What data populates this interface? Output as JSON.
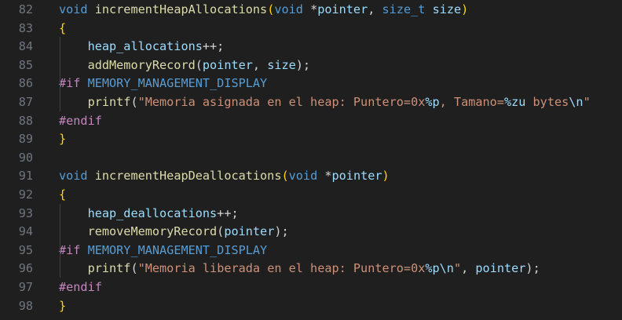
{
  "lines": [
    {
      "num": "82",
      "tokens": [
        {
          "t": "void",
          "c": "kw"
        },
        {
          "t": " ",
          "c": "plain"
        },
        {
          "t": "incrementHeapAllocations",
          "c": "fn"
        },
        {
          "t": "(",
          "c": "bracket"
        },
        {
          "t": "void",
          "c": "kw"
        },
        {
          "t": " *",
          "c": "plain"
        },
        {
          "t": "pointer",
          "c": "var"
        },
        {
          "t": ", ",
          "c": "plain"
        },
        {
          "t": "size_t",
          "c": "kw"
        },
        {
          "t": " ",
          "c": "plain"
        },
        {
          "t": "size",
          "c": "var"
        },
        {
          "t": ")",
          "c": "bracket"
        }
      ]
    },
    {
      "num": "83",
      "tokens": [
        {
          "t": "{",
          "c": "bracket"
        }
      ]
    },
    {
      "num": "84",
      "tokens": [
        {
          "t": "    ",
          "c": "plain"
        },
        {
          "t": "heap_allocations",
          "c": "var"
        },
        {
          "t": "++;",
          "c": "plain"
        }
      ]
    },
    {
      "num": "85",
      "tokens": [
        {
          "t": "    ",
          "c": "plain"
        },
        {
          "t": "addMemoryRecord",
          "c": "fn"
        },
        {
          "t": "(",
          "c": "plain"
        },
        {
          "t": "pointer",
          "c": "var"
        },
        {
          "t": ", ",
          "c": "plain"
        },
        {
          "t": "size",
          "c": "var"
        },
        {
          "t": ");",
          "c": "plain"
        }
      ]
    },
    {
      "num": "86",
      "tokens": [
        {
          "t": "#if",
          "c": "pre"
        },
        {
          "t": " ",
          "c": "plain"
        },
        {
          "t": "MEMORY_MANAGEMENT_DISPLAY",
          "c": "mac"
        }
      ]
    },
    {
      "num": "87",
      "tokens": [
        {
          "t": "    ",
          "c": "plain"
        },
        {
          "t": "printf",
          "c": "fn"
        },
        {
          "t": "(",
          "c": "plain"
        },
        {
          "t": "\"Memoria asignada en el heap: Puntero=0x",
          "c": "str"
        },
        {
          "t": "%p",
          "c": "fmt"
        },
        {
          "t": ", Tamano=",
          "c": "str"
        },
        {
          "t": "%zu",
          "c": "fmt"
        },
        {
          "t": " bytes",
          "c": "str"
        },
        {
          "t": "\\n",
          "c": "fmt"
        },
        {
          "t": "\"",
          "c": "str"
        }
      ]
    },
    {
      "num": "88",
      "tokens": [
        {
          "t": "#endif",
          "c": "pre"
        }
      ]
    },
    {
      "num": "89",
      "tokens": [
        {
          "t": "}",
          "c": "bracket"
        }
      ]
    },
    {
      "num": "90",
      "tokens": []
    },
    {
      "num": "91",
      "tokens": [
        {
          "t": "void",
          "c": "kw"
        },
        {
          "t": " ",
          "c": "plain"
        },
        {
          "t": "incrementHeapDeallocations",
          "c": "fn"
        },
        {
          "t": "(",
          "c": "bracket"
        },
        {
          "t": "void",
          "c": "kw"
        },
        {
          "t": " *",
          "c": "plain"
        },
        {
          "t": "pointer",
          "c": "var"
        },
        {
          "t": ")",
          "c": "bracket"
        }
      ]
    },
    {
      "num": "92",
      "tokens": [
        {
          "t": "{",
          "c": "bracket"
        }
      ]
    },
    {
      "num": "93",
      "tokens": [
        {
          "t": "    ",
          "c": "plain"
        },
        {
          "t": "heap_deallocations",
          "c": "var"
        },
        {
          "t": "++;",
          "c": "plain"
        }
      ]
    },
    {
      "num": "94",
      "tokens": [
        {
          "t": "    ",
          "c": "plain"
        },
        {
          "t": "removeMemoryRecord",
          "c": "fn"
        },
        {
          "t": "(",
          "c": "plain"
        },
        {
          "t": "pointer",
          "c": "var"
        },
        {
          "t": ");",
          "c": "plain"
        }
      ]
    },
    {
      "num": "95",
      "tokens": [
        {
          "t": "#if",
          "c": "pre"
        },
        {
          "t": " ",
          "c": "plain"
        },
        {
          "t": "MEMORY_MANAGEMENT_DISPLAY",
          "c": "mac"
        }
      ]
    },
    {
      "num": "96",
      "tokens": [
        {
          "t": "    ",
          "c": "plain"
        },
        {
          "t": "printf",
          "c": "fn"
        },
        {
          "t": "(",
          "c": "plain"
        },
        {
          "t": "\"Memoria liberada en el heap: Puntero=0x",
          "c": "str"
        },
        {
          "t": "%p",
          "c": "fmt"
        },
        {
          "t": "\\n",
          "c": "fmt"
        },
        {
          "t": "\"",
          "c": "str"
        },
        {
          "t": ", ",
          "c": "plain"
        },
        {
          "t": "pointer",
          "c": "var"
        },
        {
          "t": ");",
          "c": "plain"
        }
      ]
    },
    {
      "num": "97",
      "tokens": [
        {
          "t": "#endif",
          "c": "pre"
        }
      ]
    },
    {
      "num": "98",
      "tokens": [
        {
          "t": "}",
          "c": "bracket"
        }
      ]
    }
  ],
  "colors": {
    "background": "#1f1f1f",
    "line_number": "#6e7681",
    "keyword": "#569cd6",
    "function": "#dcdcaa",
    "variable": "#9cdcfe",
    "string": "#ce9178",
    "preprocessor": "#c586c0",
    "bracket": "#ffd700",
    "plain": "#d4d4d4"
  }
}
